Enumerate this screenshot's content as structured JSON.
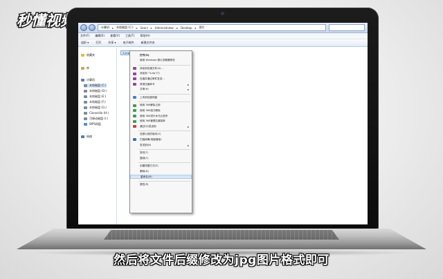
{
  "watermark": {
    "text": "秒懂视频"
  },
  "subtitle": "然后将文件后缀修改为jpg图片格式即可",
  "explorer": {
    "path": [
      "计算机",
      "本地磁盘 (C:)",
      "Users",
      "Administrator",
      "Desktop",
      "图片"
    ],
    "menu": [
      "文件(F)",
      "编辑(E)",
      "查看(V)",
      "工具(T)",
      "帮助(H)"
    ],
    "toolbar": [
      "组织 ▾",
      "打开",
      "共享 ▾",
      "电子邮件",
      "新建文件夹"
    ],
    "file_label": "3.png",
    "sidebar": [
      {
        "label": "收藏夹",
        "icon": "star-icon",
        "color": "#e8b830"
      },
      {
        "label": "库",
        "icon": "library-icon",
        "color": "#d9a441"
      },
      {
        "label": "计算机",
        "icon": "computer-icon",
        "color": "#5f7fa8"
      },
      {
        "label": "本地磁盘 (C:)",
        "icon": "drive-icon",
        "color": "#7d8a99"
      },
      {
        "label": "本地磁盘 (D:)",
        "icon": "drive-icon",
        "color": "#7d8a99"
      },
      {
        "label": "本地磁盘 (E:)",
        "icon": "drive-icon",
        "color": "#7d8a99"
      },
      {
        "label": "本地磁盘 (F:)",
        "icon": "drive-icon",
        "color": "#7d8a99"
      },
      {
        "label": "本地磁盘 (G:)",
        "icon": "drive-icon",
        "color": "#7d8a99"
      },
      {
        "label": "Clonezilla (H:)",
        "icon": "drive-icon",
        "color": "#7d8a99"
      },
      {
        "label": "可移动磁盘 (I:)",
        "icon": "usb-icon",
        "color": "#7d8a99"
      },
      {
        "label": "WPS网盘",
        "icon": "cloud-icon",
        "color": "#4a8fd6"
      },
      {
        "label": "网络",
        "icon": "network-icon",
        "color": "#4f7cae"
      }
    ],
    "context_menu": [
      {
        "label": "打开(O)",
        "bold": true,
        "color": ""
      },
      {
        "label": "使用 Windows 照片查看器预览",
        "color": ""
      },
      {
        "label": "添加到压缩文件(A)...",
        "color": "#9b3fa7"
      },
      {
        "label": "添加到 \"3.zip\"(T)",
        "color": "#9b3fa7"
      },
      {
        "label": "压缩并通过邮件发送...",
        "color": "#9b3fa7"
      },
      {
        "label": "其他压缩命令",
        "color": "#9b3fa7",
        "sub": true
      },
      {
        "label": "共享(H)",
        "color": "",
        "sub": true
      },
      {
        "label": "上传到百度网盘",
        "color": "#3d83d6"
      },
      {
        "label": "使用 360解除占用",
        "color": "#3aa04a"
      },
      {
        "label": "使用 360强力删除",
        "color": "#3aa04a"
      },
      {
        "label": "使用 360进行木马云查杀",
        "color": "#3aa04a"
      },
      {
        "label": "使用 360管理右键菜单",
        "color": "#3aa04a"
      },
      {
        "label": "通过QQ发送到",
        "color": "#d63a3a",
        "sub": true
      },
      {
        "label": "还原以前的版本(V)",
        "color": ""
      },
      {
        "label": "扫描病毒(电脑管家)",
        "color": "#2f6fc8"
      },
      {
        "label": "发送到(N)",
        "color": "",
        "sub": true
      },
      {
        "label": "剪切(T)",
        "color": ""
      },
      {
        "label": "复制(C)",
        "color": ""
      },
      {
        "label": "创建快捷方式(S)",
        "color": ""
      },
      {
        "label": "删除(D)",
        "color": ""
      },
      {
        "label": "重命名(M)",
        "color": "",
        "highlight": true
      },
      {
        "label": "属性(R)",
        "color": ""
      }
    ]
  }
}
